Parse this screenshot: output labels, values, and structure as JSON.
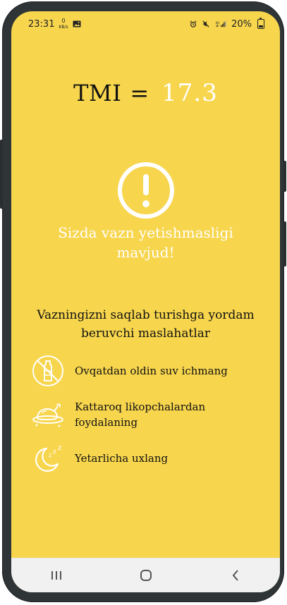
{
  "status": {
    "time": "23:31",
    "network_speed": {
      "value": "0",
      "unit": "KB/s"
    },
    "battery": "20%"
  },
  "header": {
    "label": "TMI",
    "equals": "=",
    "value": "17.3"
  },
  "alert": {
    "icon": "exclamation-circle-icon",
    "message": "Sizda vazn yetishmasligi mavjud!"
  },
  "tips": {
    "heading": "Vazningizni saqlab turishga yordam beruvchi maslahatlar",
    "items": [
      {
        "icon": "no-water-bottle-icon",
        "text": "Ovqatdan oldin suv ichmang"
      },
      {
        "icon": "roast-chicken-plate-icon",
        "text": "Kattaroq likopchalardan foydalaning"
      },
      {
        "icon": "moon-sleep-icon",
        "text": "Yetarlicha uxlang"
      }
    ]
  },
  "colors": {
    "background": "#f7d54d",
    "accent": "#ffffff",
    "text": "#111111"
  }
}
